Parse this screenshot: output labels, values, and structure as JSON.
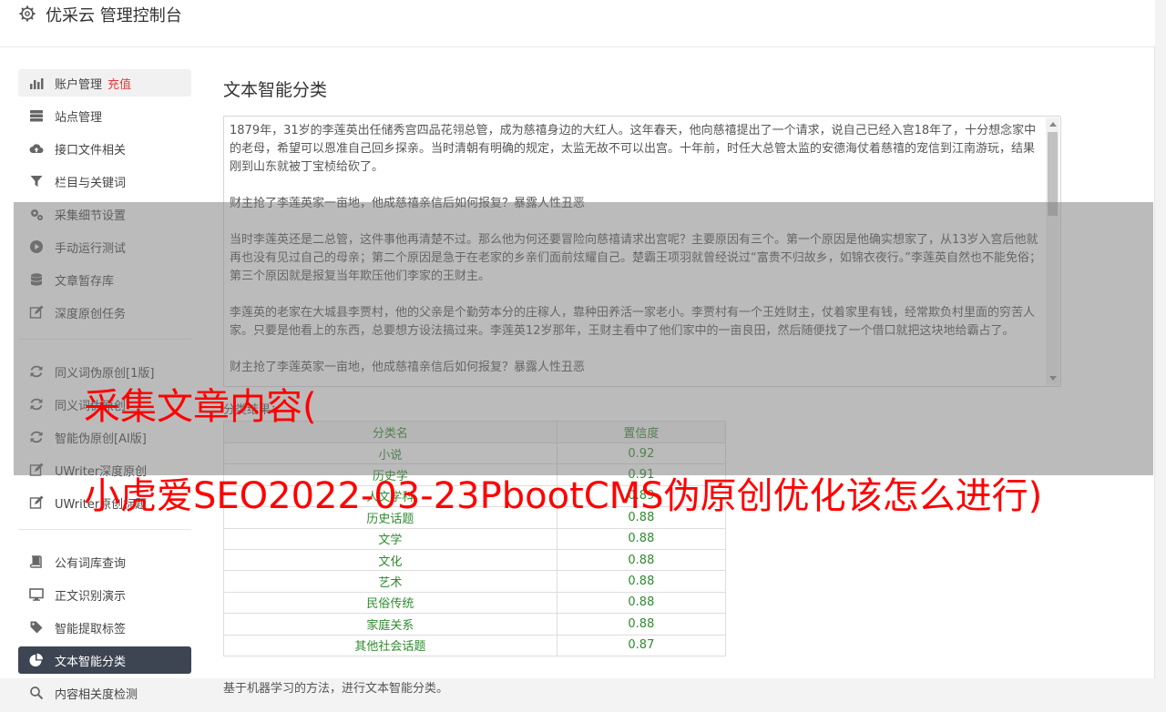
{
  "header": {
    "title": "优采云 管理控制台"
  },
  "sidebar": {
    "group1": [
      {
        "label": "账户管理",
        "badge": "充值",
        "icon": "bar-chart-icon",
        "state": "light"
      },
      {
        "label": "站点管理",
        "icon": "server-icon"
      },
      {
        "label": "接口文件相关",
        "icon": "cloud-upload-icon"
      },
      {
        "label": "栏目与关键词",
        "icon": "filter-icon"
      },
      {
        "label": "采集细节设置",
        "icon": "gears-icon"
      },
      {
        "label": "手动运行测试",
        "icon": "play-circle-icon"
      },
      {
        "label": "文章暂存库",
        "icon": "database-icon"
      },
      {
        "label": "深度原创任务",
        "icon": "edit-icon"
      }
    ],
    "group2": [
      {
        "label": "同义词伪原创[1版]",
        "icon": "refresh-icon"
      },
      {
        "label": "同义词伪原创",
        "icon": "refresh-icon"
      },
      {
        "label": "智能伪原创[AI版]",
        "icon": "refresh-icon"
      },
      {
        "label": "UWriter深度原创",
        "icon": "edit-icon"
      },
      {
        "label": "UWriter原创标题",
        "icon": "edit-icon"
      }
    ],
    "group3": [
      {
        "label": "公有词库查询",
        "icon": "book-icon"
      },
      {
        "label": "正文识别演示",
        "icon": "monitor-icon"
      },
      {
        "label": "智能提取标签",
        "icon": "tag-icon"
      },
      {
        "label": "文本智能分类",
        "icon": "pie-chart-icon",
        "state": "dark"
      },
      {
        "label": "内容相关度检测",
        "icon": "search-icon"
      }
    ]
  },
  "main": {
    "title": "文本智能分类",
    "text_paragraphs": [
      "1879年，31岁的李莲英出任储秀宫四品花翎总管，成为慈禧身边的大红人。这年春天，他向慈禧提出了一个请求，说自己已经入宫18年了，十分想念家中的老母，希望可以恩准自己回乡探亲。当时清朝有明确的规定，太监无故不可以出宫。十年前，时任大总管太监的安德海仗着慈禧的宠信到江南游玩，结果刚到山东就被丁宝桢给砍了。",
      "财主抢了李莲英家一亩地，他成慈禧亲信后如何报复？暴露人性丑恶",
      "当时李莲英还是二总管，这件事他再清楚不过。那么他为何还要冒险向慈禧请求出宫呢？主要原因有三个。第一个原因是他确实想家了，从13岁入宫后他就再也没有见过自己的母亲；第二个原因是急于在老家的乡亲们面前炫耀自己。楚霸王项羽就曾经说过“富贵不归故乡，如锦衣夜行。”李莲英自然也不能免俗；第三个原因就是报复当年欺压他们李家的王财主。",
      "李莲英的老家在大城县李贾村，他的父亲是个勤劳本分的庄稼人，靠种田养活一家老小。李贾村有一个王姓财主，仗着家里有钱，经常欺负村里面的穷苦人家。只要是他看上的东西，总要想方设法搞过来。李莲英12岁那年，王财主看中了他们家中的一亩良田，然后随便找了一个借口就把这块地给霸占了。",
      "财主抢了李莲英家一亩地，他成慈禧亲信后如何报复？暴露人性丑恶"
    ],
    "result_label": "分类结果：",
    "table": {
      "headers": [
        "分类名",
        "置信度"
      ],
      "rows": [
        [
          "小说",
          "0.92"
        ],
        [
          "历史学",
          "0.91"
        ],
        [
          "人文学科",
          "0.89"
        ],
        [
          "历史话题",
          "0.88"
        ],
        [
          "文学",
          "0.88"
        ],
        [
          "文化",
          "0.88"
        ],
        [
          "艺术",
          "0.88"
        ],
        [
          "民俗传统",
          "0.88"
        ],
        [
          "家庭关系",
          "0.88"
        ],
        [
          "其他社会话题",
          "0.87"
        ]
      ]
    },
    "footnote": "基于机器学习的方法，进行文本智能分类。"
  },
  "overlay": {
    "line1": "采集文章内容(",
    "line2": "小虎爱SEO2022-03-23PbootCMS伪原创优化该怎么进行)"
  },
  "colors": {
    "accent_dark": "#3d4553",
    "badge_red": "#e4393c",
    "table_green": "#2e8b2e",
    "overlay_red": "#ff0000"
  }
}
